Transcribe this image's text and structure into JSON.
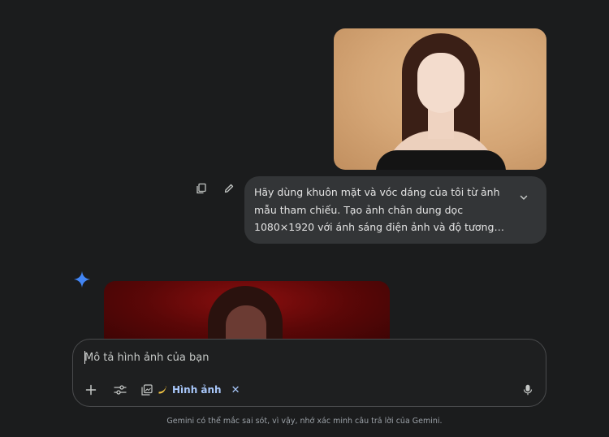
{
  "user_message": {
    "image_alt": "Ảnh mẫu tham chiếu",
    "text": "Hãy dùng khuôn mặt và vóc dáng của tôi từ ảnh mẫu tham chiếu. Tạo ảnh chân dung dọc 1080×1920 với ánh sáng điện ảnh và độ tương phản mạnh. Giữ nguyên dáng"
  },
  "composer": {
    "placeholder": "Mô tả hình ảnh của bạn",
    "chip_label": "Hình ảnh",
    "chip_close": "✕"
  },
  "disclaimer": "Gemini có thể mắc sai sót, vì vậy, nhớ xác minh câu trả lời của Gemini.",
  "colors": {
    "background": "#1b1c1d",
    "bubble": "#333537",
    "accent": "#a8c7fa",
    "spark": "#4285f4"
  },
  "icons": [
    "copy-icon",
    "edit-icon",
    "chevron-down-icon",
    "gemini-spark-icon",
    "plus-icon",
    "tools-icon",
    "image-gallery-icon",
    "banana-icon",
    "close-icon",
    "mic-icon"
  ]
}
